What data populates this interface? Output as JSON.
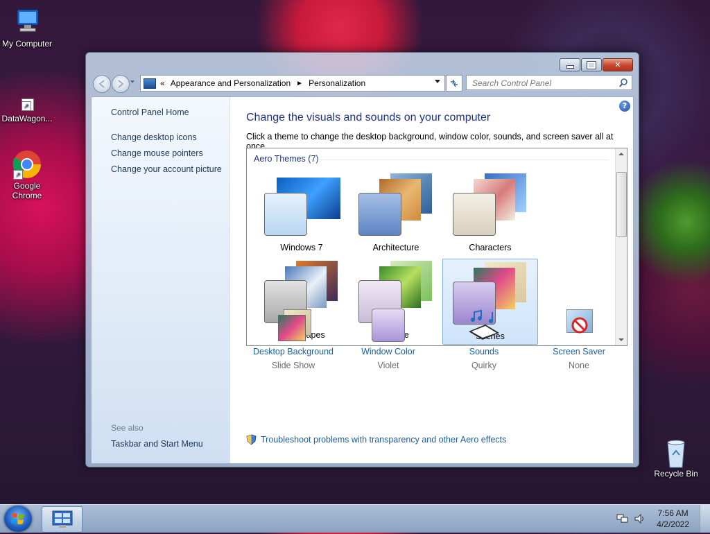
{
  "desktop": {
    "icons": [
      {
        "label": "My Computer"
      },
      {
        "label": "DataWagon..."
      },
      {
        "label": "Google Chrome"
      },
      {
        "label": "Recycle Bin"
      }
    ]
  },
  "window": {
    "caption_buttons": {
      "minimize": "minimize",
      "maximize": "maximize",
      "close": "close"
    },
    "address": {
      "chevron": "«",
      "crumbs": [
        "Appearance and Personalization",
        "Personalization"
      ],
      "separator": "►"
    },
    "search": {
      "placeholder": "Search Control Panel"
    },
    "left_pane": {
      "home": "Control Panel Home",
      "links": [
        "Change desktop icons",
        "Change mouse pointers",
        "Change your account picture"
      ],
      "see_also": "See also",
      "see_also_links": [
        "Taskbar and Start Menu"
      ]
    },
    "main": {
      "help": "?",
      "heading": "Change the visuals and sounds on your computer",
      "description": "Click a theme to change the desktop background, window color, sounds, and screen saver all at once.",
      "group_header": "Aero Themes (7)",
      "themes": [
        {
          "name": "Windows 7",
          "swatch": "#bcd8f2"
        },
        {
          "name": "Architecture",
          "swatch": "#7e9fd0"
        },
        {
          "name": "Characters",
          "swatch": "#e6e0d2"
        },
        {
          "name": "Landscapes",
          "swatch": "#bdbdbd"
        },
        {
          "name": "Nature",
          "swatch": "#dcd2e8"
        },
        {
          "name": "Scenes",
          "swatch": "#b7a6de",
          "selected": true
        }
      ],
      "bottom": [
        {
          "name": "Desktop Background",
          "sub": "Slide Show"
        },
        {
          "name": "Window Color",
          "sub": "Violet"
        },
        {
          "name": "Sounds",
          "sub": "Quirky"
        },
        {
          "name": "Screen Saver",
          "sub": "None"
        }
      ],
      "troubleshoot": "Troubleshoot problems with transparency and other Aero effects"
    }
  },
  "taskbar": {
    "time": "7:56 AM",
    "date": "4/2/2022"
  }
}
